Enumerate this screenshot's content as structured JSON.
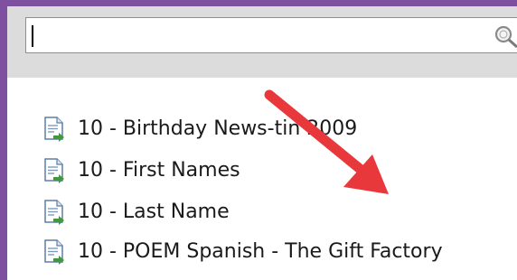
{
  "search": {
    "value": "",
    "icon": "search-icon"
  },
  "files": [
    {
      "label": "10 - Birthday News-tin 2009",
      "icon": "document-icon"
    },
    {
      "label": "10 - First Names",
      "icon": "document-icon"
    },
    {
      "label": "10 - Last Name",
      "icon": "document-icon"
    },
    {
      "label": "10 - POEM Spanish - The Gift Factory",
      "icon": "document-icon"
    }
  ],
  "colors": {
    "frame": "#7f4fa0",
    "toolbar": "#dcdcdc",
    "annotation_arrow": "#e8383b"
  }
}
